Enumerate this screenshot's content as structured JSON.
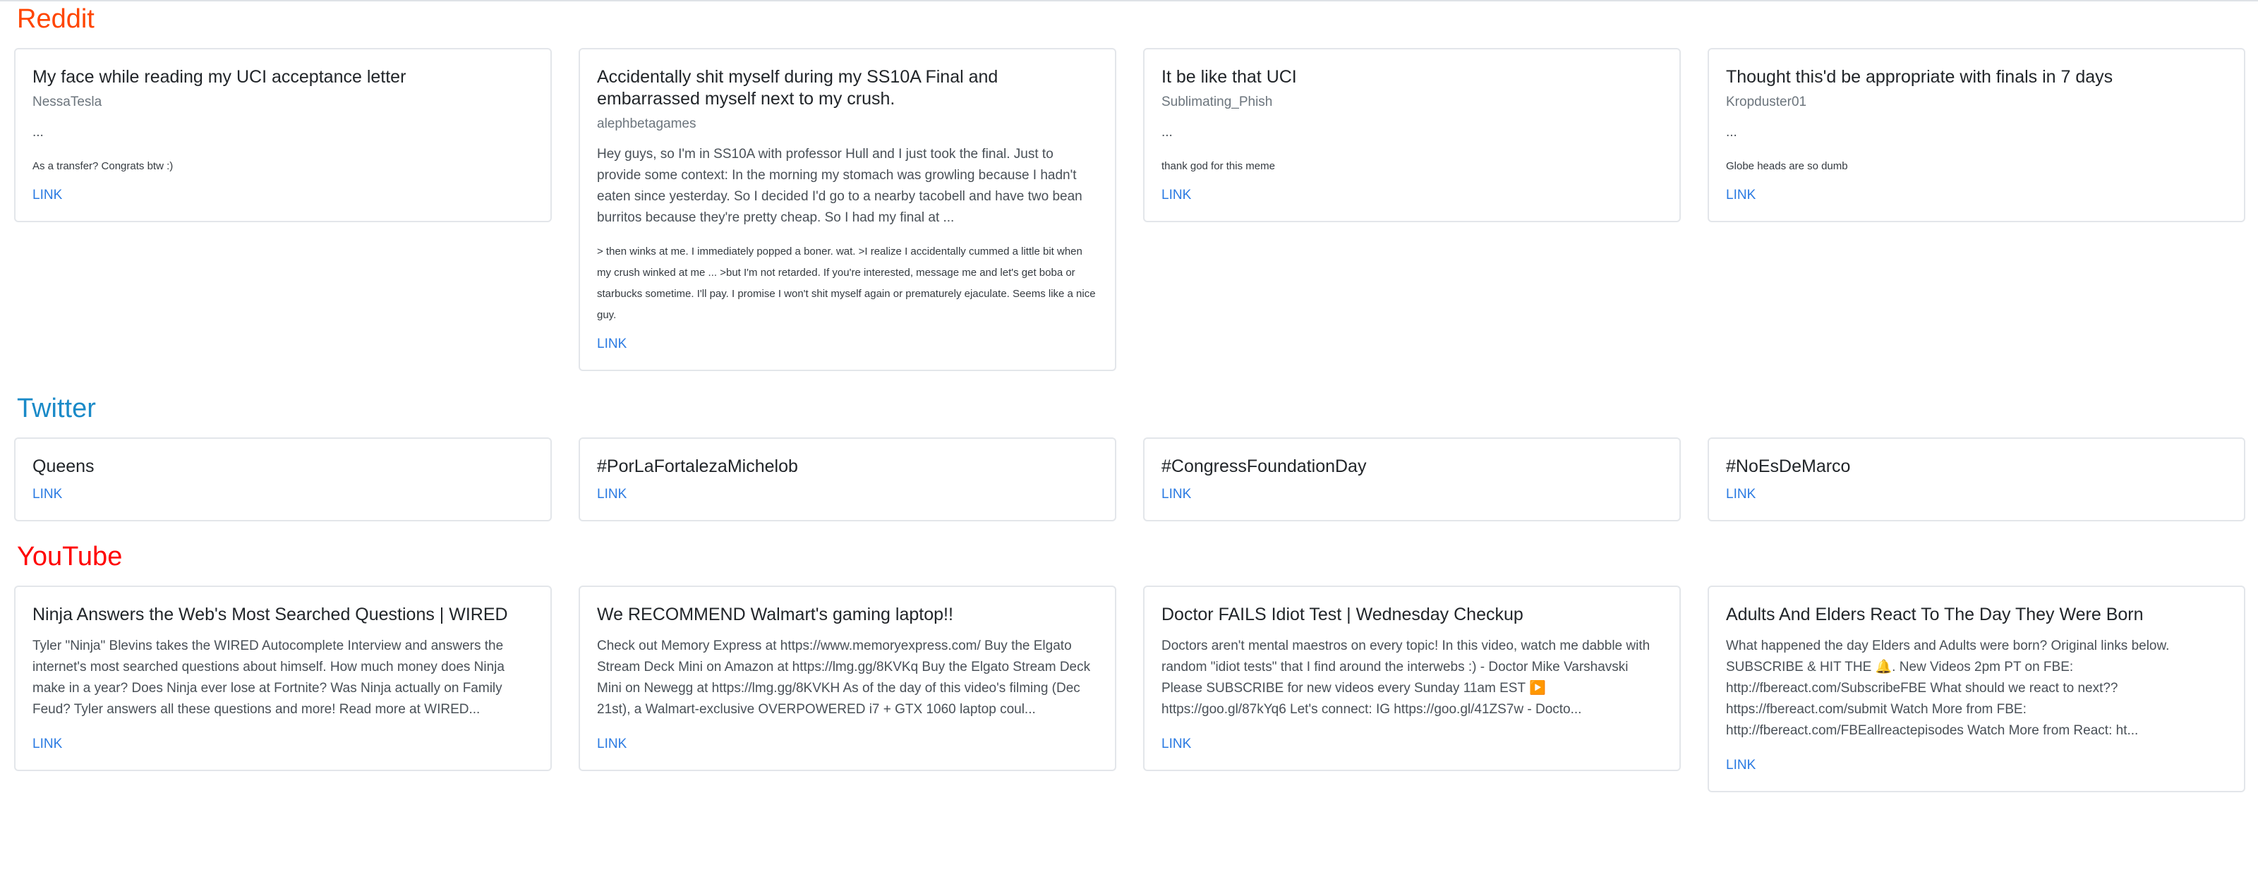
{
  "sections": {
    "reddit": "Reddit",
    "twitter": "Twitter",
    "youtube": "YouTube"
  },
  "link_label": "LINK",
  "colors": {
    "reddit": "#ff4500",
    "twitter": "#1a8ac8",
    "youtube": "#ff0000",
    "link": "#2a7ae2"
  },
  "reddit": [
    {
      "title": "My face while reading my UCI acceptance letter",
      "author": "NessaTesla",
      "desc": "...",
      "comment": "As a transfer? Congrats btw :)"
    },
    {
      "title": "Accidentally shit myself during my SS10A Final and embarrassed myself next to my crush.",
      "author": "alephbetagames",
      "desc": "Hey guys, so I'm in SS10A with professor Hull and I just took the final. Just to provide some context: In the morning my stomach was growling because I hadn't eaten since yesterday. So I decided I'd go to a nearby tacobell and have two bean burritos because they're pretty cheap. So I had my final at ...",
      "comment": "> then winks at me. I immediately popped a boner. wat. >I realize I accidentally cummed a little bit when my crush winked at me ... >but I'm not retarded. If you're interested, message me and let's get boba or starbucks sometime. I'll pay. I promise I won't shit myself again or prematurely ejaculate. Seems like a nice guy."
    },
    {
      "title": "It be like that UCI",
      "author": "Sublimating_Phish",
      "desc": "...",
      "comment": "thank god for this meme"
    },
    {
      "title": "Thought this'd be appropriate with finals in 7 days",
      "author": "Kropduster01",
      "desc": "...",
      "comment": "Globe heads are so dumb"
    }
  ],
  "twitter": [
    {
      "title": "Queens"
    },
    {
      "title": "#PorLaFortalezaMichelob"
    },
    {
      "title": "#CongressFoundationDay"
    },
    {
      "title": "#NoEsDeMarco"
    }
  ],
  "youtube": [
    {
      "title": "Ninja Answers the Web's Most Searched Questions | WIRED",
      "desc": "Tyler \"Ninja\" Blevins takes the WIRED Autocomplete Interview and answers the internet's most searched questions about himself. How much money does Ninja make in a year? Does Ninja ever lose at Fortnite? Was Ninja actually on Family Feud? Tyler answers all these questions and more! Read more at WIRED..."
    },
    {
      "title": "We RECOMMEND Walmart's gaming laptop!!",
      "desc": "Check out Memory Express at https://www.memoryexpress.com/ Buy the Elgato Stream Deck Mini on Amazon at https://lmg.gg/8KVKq Buy the Elgato Stream Deck Mini on Newegg at https://lmg.gg/8KVKH As of the day of this video's filming (Dec 21st), a Walmart-exclusive OVERPOWERED i7 + GTX 1060 laptop coul..."
    },
    {
      "title": "Doctor FAILS Idiot Test | Wednesday Checkup",
      "desc": "Doctors aren't mental maestros on every topic! In this video, watch me dabble with random \"idiot tests\" that I find around the interwebs :) - Doctor Mike Varshavski Please SUBSCRIBE for new videos every Sunday 11am EST ▶️ https://goo.gl/87kYq6 Let's connect: IG https://goo.gl/41ZS7w - Docto..."
    },
    {
      "title": "Adults And Elders React To The Day They Were Born",
      "desc": "What happened the day Elders and Adults were born? Original links below. SUBSCRIBE & HIT THE 🔔. New Videos 2pm PT on FBE: http://fbereact.com/SubscribeFBE What should we react to next?? https://fbereact.com/submit Watch More from FBE: http://fbereact.com/FBEallreactepisodes Watch More from React: ht..."
    }
  ]
}
